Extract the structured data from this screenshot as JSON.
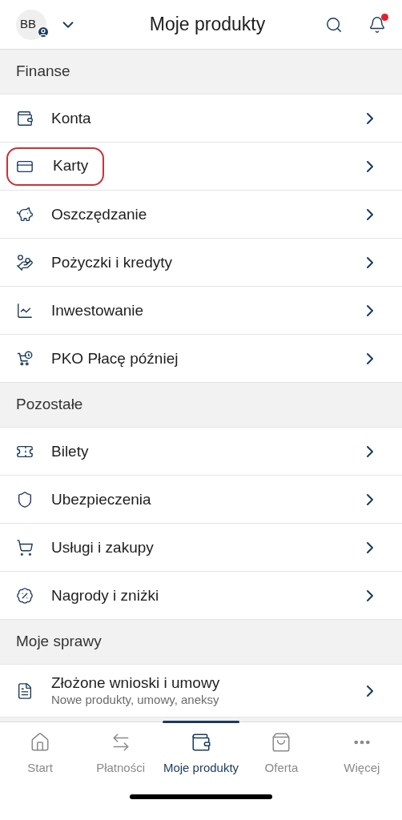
{
  "header": {
    "avatar_initials": "BB",
    "title": "Moje produkty",
    "notification_dot": true
  },
  "sections": [
    {
      "title": "Finanse",
      "items": [
        {
          "label": "Konta",
          "kind": "wallet",
          "highlighted": false
        },
        {
          "label": "Karty",
          "kind": "cards",
          "highlighted": true
        },
        {
          "label": "Oszczędzanie",
          "kind": "piggy",
          "highlighted": false
        },
        {
          "label": "Pożyczki i kredyty",
          "kind": "loan",
          "highlighted": false
        },
        {
          "label": "Inwestowanie",
          "kind": "chart",
          "highlighted": false
        },
        {
          "label": "PKO Płacę później",
          "kind": "cart-clock",
          "highlighted": false
        }
      ]
    },
    {
      "title": "Pozostałe",
      "items": [
        {
          "label": "Bilety",
          "kind": "ticket",
          "highlighted": false
        },
        {
          "label": "Ubezpieczenia",
          "kind": "shield",
          "highlighted": false
        },
        {
          "label": "Usługi i zakupy",
          "kind": "cart",
          "highlighted": false
        },
        {
          "label": "Nagrody i zniżki",
          "kind": "percent",
          "highlighted": false
        }
      ]
    },
    {
      "title": "Moje sprawy",
      "items": [
        {
          "label": "Złożone wnioski i umowy",
          "subtitle": "Nowe produkty, umowy, aneksy",
          "kind": "document",
          "highlighted": false
        }
      ]
    }
  ],
  "nav": [
    {
      "label": "Start",
      "kind": "home",
      "selected": false
    },
    {
      "label": "Płatności",
      "kind": "transfer",
      "selected": false
    },
    {
      "label": "Moje produkty",
      "kind": "wallet",
      "selected": true
    },
    {
      "label": "Oferta",
      "kind": "bag",
      "selected": false
    },
    {
      "label": "Więcej",
      "kind": "more",
      "selected": false
    }
  ]
}
